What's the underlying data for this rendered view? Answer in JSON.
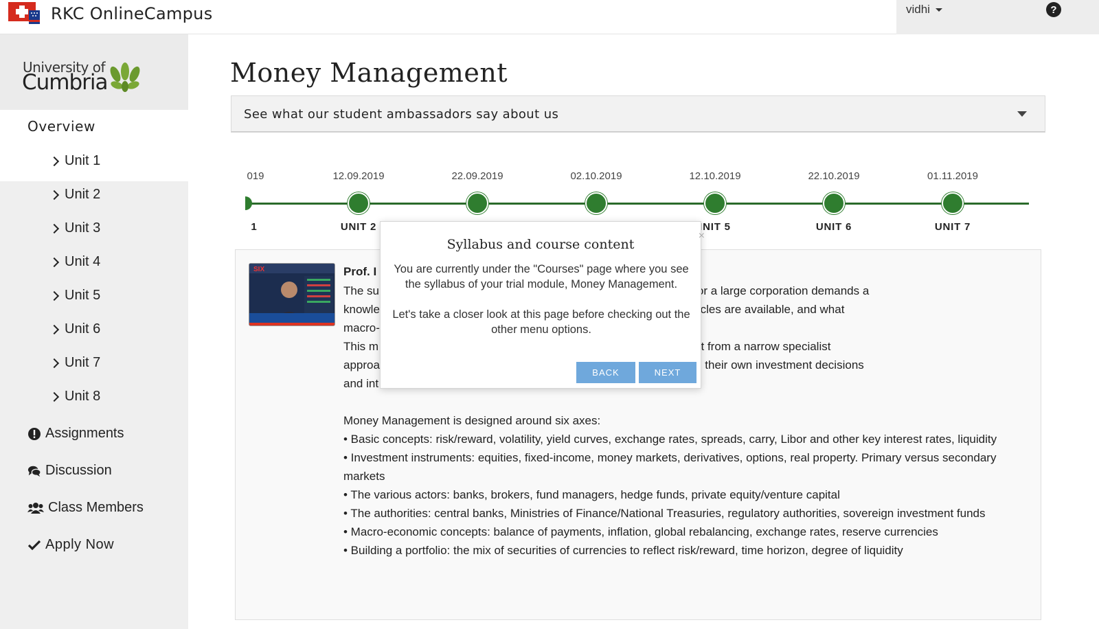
{
  "app": {
    "title": "RKC OnlineCampus"
  },
  "user": {
    "name": "vidhi"
  },
  "university": {
    "line1": "University of",
    "line2": "Cumbria"
  },
  "sidebar": {
    "overview": "Overview",
    "units": [
      "Unit 1",
      "Unit 2",
      "Unit 3",
      "Unit 4",
      "Unit 5",
      "Unit 6",
      "Unit 7",
      "Unit 8"
    ],
    "assignments": "Assignments",
    "discussion": "Discussion",
    "class_members": "Class Members",
    "apply_now": "Apply Now"
  },
  "page": {
    "title": "Money Management",
    "accordion_label": "See what our student ambassadors say about us"
  },
  "timeline": {
    "first_date_fragment": "019",
    "first_label_fragment": "1",
    "dates": [
      "12.09.2019",
      "22.09.2019",
      "02.10.2019",
      "12.10.2019",
      "22.10.2019",
      "01.11.2019"
    ],
    "labels": [
      "UNIT 2",
      "",
      "",
      "INIT 5",
      "UNIT 6",
      "UNIT 7"
    ]
  },
  "card": {
    "prof_name": "Prof. I",
    "lines": [
      "The su                                                           vidual, a small business or a large corporation demands a",
      "knowle                                                           ents and investment vehicles are available, and what",
      "macro-",
      "This m                                                           ancial markets (as distinct from a narrow specialist",
      "approa                                                           o that students can make their own investment decisions",
      "and int"
    ],
    "axes_intro": "Money Management is designed around six axes:",
    "axes": [
      "• Basic concepts: risk/reward, volatility, yield curves, exchange rates, spreads, carry, Libor and other key interest rates, liquidity",
      "• Investment instruments: equities, fixed-income, money markets, derivatives, options, real property. Primary versus secondary markets",
      "• The various actors: banks, brokers, fund managers, hedge funds, private equity/venture capital",
      "• The authorities: central banks, Ministries of Finance/National Treasuries, regulatory authorities, sovereign investment funds",
      "• Macro-economic concepts: balance of payments, inflation, global rebalancing, exchange rates, reserve currencies",
      "• Building a portfolio: the mix of securities of currencies to reflect risk/reward, time horizon, degree of liquidity"
    ]
  },
  "popover": {
    "title": "Syllabus and course content",
    "para1": "You are currently under the \"Courses\" page where you see the syllabus of your trial module, Money Management.",
    "para2": "Let's take a closer look at this page before checking out the other menu options.",
    "back": "BACK",
    "next": "NEXT",
    "close": "×"
  },
  "colors": {
    "timeline_green": "#2f7d2f",
    "button_blue": "#6fa8dc",
    "sidebar_bg": "#efefef"
  }
}
